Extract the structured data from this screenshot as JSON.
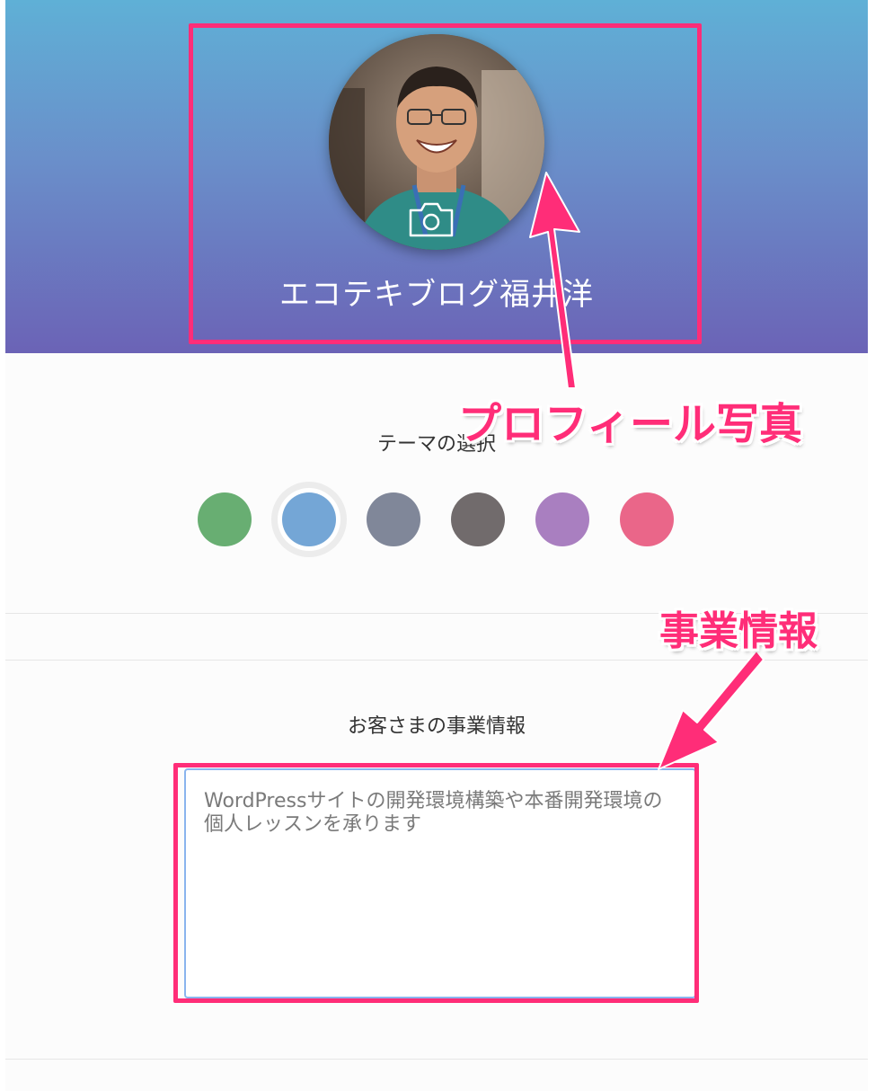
{
  "profile": {
    "name": "エコテキブログ福井洋",
    "photo_icon": "camera-icon"
  },
  "theme": {
    "title": "テーマの選択",
    "selected_index": 1,
    "swatches": [
      {
        "color": "#68ae72"
      },
      {
        "color": "#74a6d6"
      },
      {
        "color": "#808799"
      },
      {
        "color": "#716b6c"
      },
      {
        "color": "#a97fc0"
      },
      {
        "color": "#ea6689"
      }
    ]
  },
  "business": {
    "title": "お客さまの事業情報",
    "value": "WordPressサイトの開発環境構築や本番開発環境の個人レッスンを承ります"
  },
  "annotations": {
    "profile_label": "プロフィール写真",
    "business_label": "事業情報",
    "highlight_color": "#ff2d78"
  }
}
